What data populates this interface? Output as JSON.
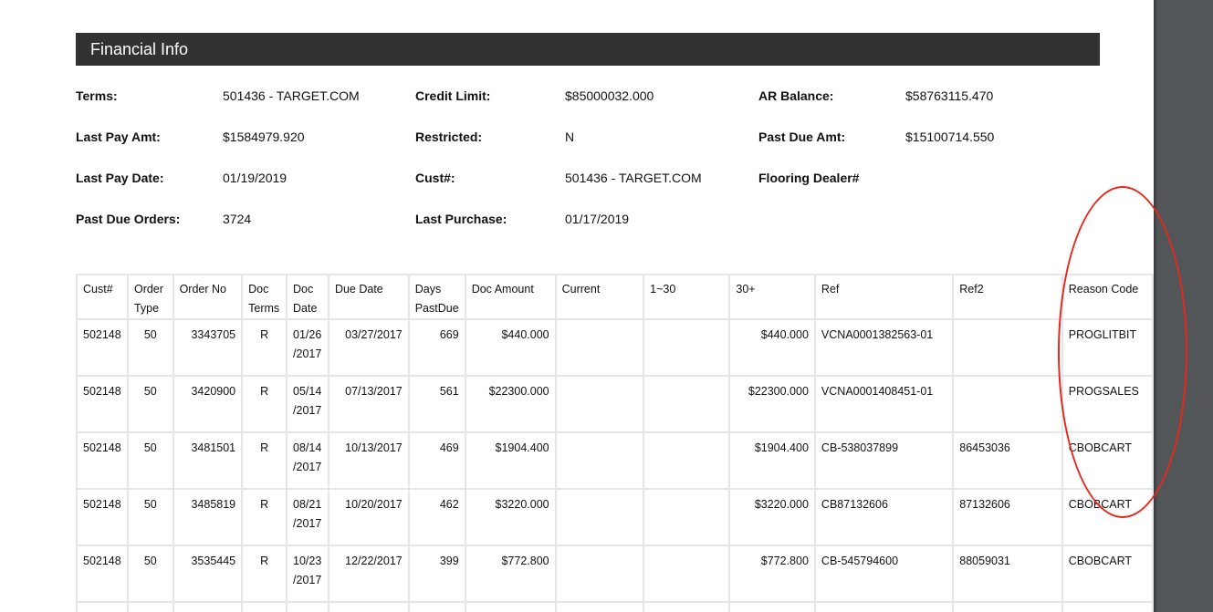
{
  "section": {
    "title": "Financial Info"
  },
  "info": [
    {
      "label": "Terms:",
      "value": "501436 - TARGET.COM"
    },
    {
      "label": "Credit Limit:",
      "value": "$85000032.000"
    },
    {
      "label": "AR Balance:",
      "value": "$58763115.470"
    },
    {
      "label": "Last Pay Amt:",
      "value": "$1584979.920"
    },
    {
      "label": "Restricted:",
      "value": "N"
    },
    {
      "label": "Past Due Amt:",
      "value": "$15100714.550"
    },
    {
      "label": "Last Pay Date:",
      "value": "01/19/2019"
    },
    {
      "label": "Cust#:",
      "value": "501436 - TARGET.COM"
    },
    {
      "label": "Flooring Dealer#",
      "value": ""
    },
    {
      "label": "Past Due Orders:",
      "value": "3724"
    },
    {
      "label": "Last Purchase:",
      "value": "01/17/2019"
    }
  ],
  "table": {
    "headers": [
      "Cust#",
      "Order Type",
      "Order No",
      "Doc Terms",
      "Doc Date",
      "Due Date",
      "Days PastDue",
      "Doc Amount",
      "Current",
      "1~30",
      "30+",
      "Ref",
      "Ref2",
      "Reason Code"
    ],
    "rows": [
      [
        "502148",
        "50",
        "3343705",
        "R",
        "01/26 /2017",
        "03/27/2017",
        "669",
        "$440.000",
        "",
        "",
        "$440.000",
        "VCNA0001382563-01",
        "",
        "PROGLITBIT"
      ],
      [
        "502148",
        "50",
        "3420900",
        "R",
        "05/14 /2017",
        "07/13/2017",
        "561",
        "$22300.000",
        "",
        "",
        "$22300.000",
        "VCNA0001408451-01",
        "",
        "PROGSALES"
      ],
      [
        "502148",
        "50",
        "3481501",
        "R",
        "08/14 /2017",
        "10/13/2017",
        "469",
        "$1904.400",
        "",
        "",
        "$1904.400",
        "CB-538037899",
        "86453036",
        "CBOBCART"
      ],
      [
        "502148",
        "50",
        "3485819",
        "R",
        "08/21 /2017",
        "10/20/2017",
        "462",
        "$3220.000",
        "",
        "",
        "$3220.000",
        "CB87132606",
        "87132606",
        "CBOBCART"
      ],
      [
        "502148",
        "50",
        "3535445",
        "R",
        "10/23 /2017",
        "12/22/2017",
        "399",
        "$772.800",
        "",
        "",
        "$772.800",
        "CB-545794600",
        "88059031",
        "CBOBCART"
      ]
    ]
  },
  "colors": {
    "header_bg": "#323232",
    "annotation": "#e8271c",
    "viewer_bg": "#525659"
  }
}
